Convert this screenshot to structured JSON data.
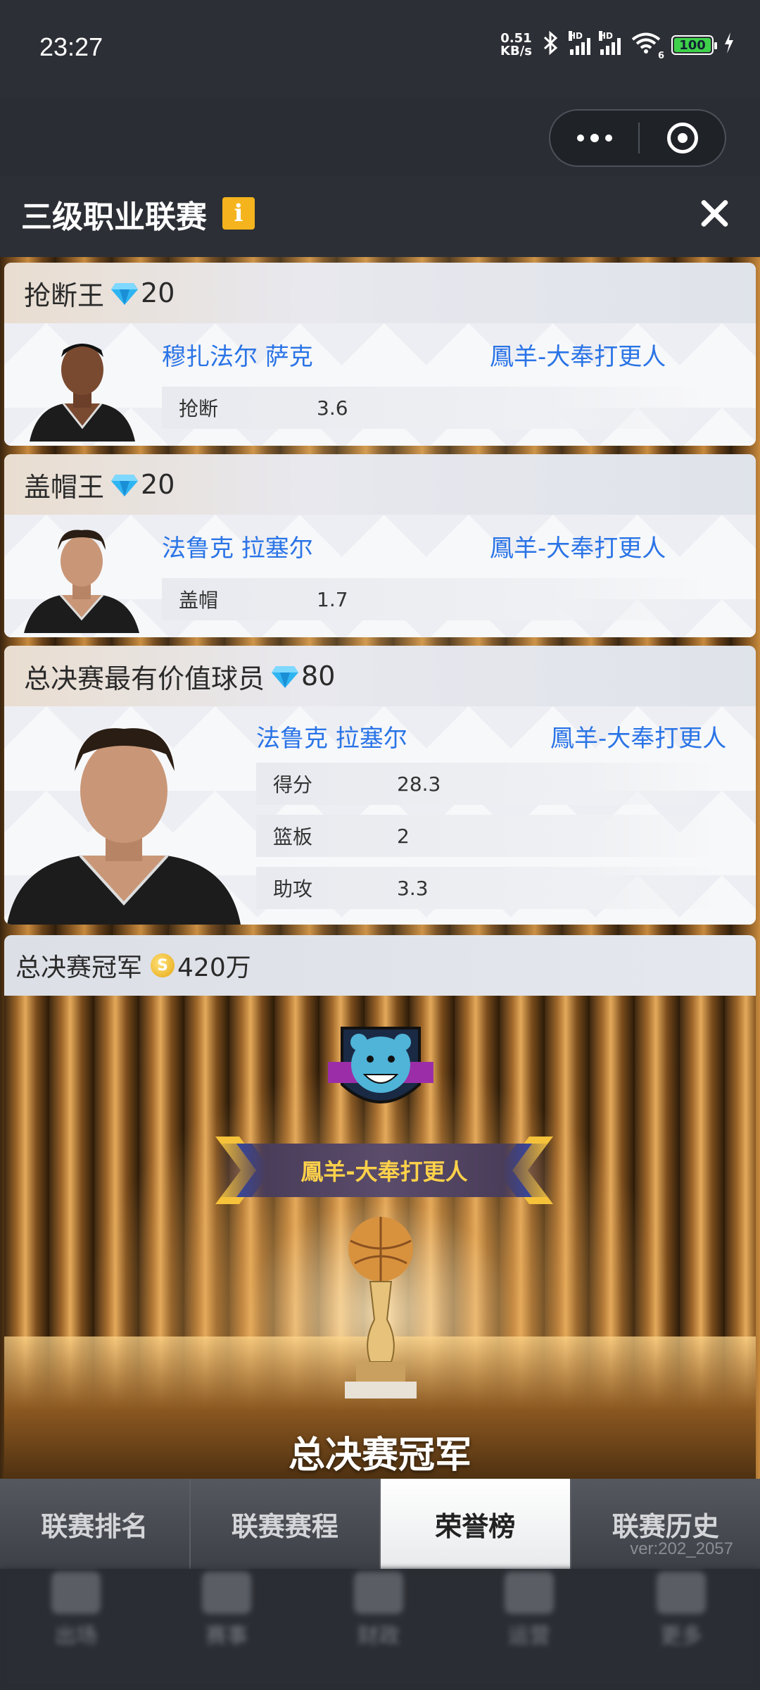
{
  "status_bar": {
    "time": "23:27",
    "net_speed_value": "0.51",
    "net_speed_unit": "KB/s",
    "signal_label": "HD",
    "wifi_label": "6",
    "battery": "100"
  },
  "header": {
    "title": "三级职业联赛",
    "info_icon": "i"
  },
  "awards": [
    {
      "title": "抢断王",
      "reward": "20",
      "reward_icon": "diamond-icon",
      "player": "穆扎法尔 萨克",
      "team": "鳳羊-大奉打更人",
      "stats": [
        {
          "label": "抢断",
          "value": "3.6"
        }
      ]
    },
    {
      "title": "盖帽王",
      "reward": "20",
      "reward_icon": "diamond-icon",
      "player": "法鲁克 拉塞尔",
      "team": "鳳羊-大奉打更人",
      "stats": [
        {
          "label": "盖帽",
          "value": "1.7"
        }
      ]
    },
    {
      "title": "总决赛最有价值球员",
      "reward": "80",
      "reward_icon": "diamond-icon",
      "player": "法鲁克 拉塞尔",
      "team": "鳳羊-大奉打更人",
      "stats": [
        {
          "label": "得分",
          "value": "28.3"
        },
        {
          "label": "篮板",
          "value": "2"
        },
        {
          "label": "助攻",
          "value": "3.3"
        }
      ]
    }
  ],
  "champion": {
    "title": "总决赛冠军",
    "reward": "420万",
    "reward_icon": "coin-icon",
    "team": "鳳羊-大奉打更人",
    "caption": "总决赛冠军"
  },
  "tabs": [
    {
      "label": "联赛排名",
      "active": false
    },
    {
      "label": "联赛赛程",
      "active": false
    },
    {
      "label": "荣誉榜",
      "active": true
    },
    {
      "label": "联赛历史",
      "active": false
    }
  ],
  "bottom_nav": [
    "出场",
    "赛事",
    "财政",
    "运营",
    "更多"
  ],
  "version": "ver:202_2057",
  "colors": {
    "accent_blue": "#2a74e6",
    "gold": "#ffd24a",
    "info_yellow": "#f5b41e"
  }
}
